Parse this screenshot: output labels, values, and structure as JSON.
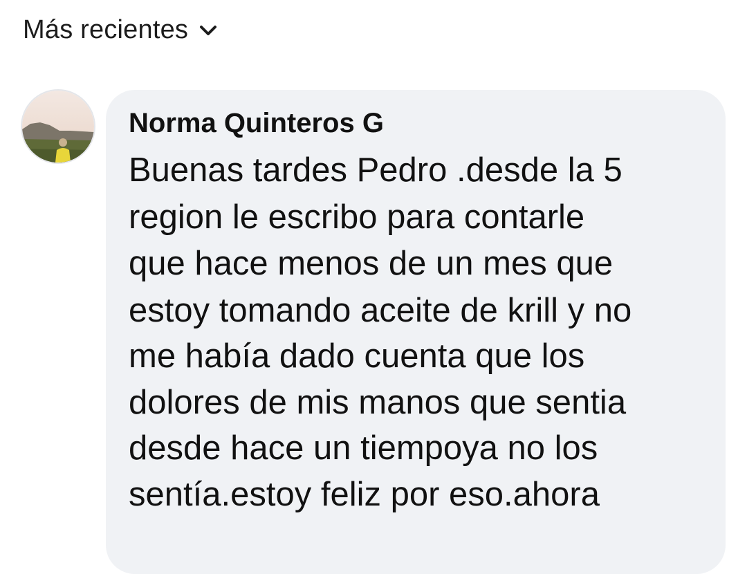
{
  "sort": {
    "label": "Más recientes",
    "icon": "chevron-down-icon"
  },
  "comment": {
    "author": "Norma Quinteros G",
    "avatar": "profile-photo",
    "bubble_color": "#f0f2f5",
    "lines": [
      "Buenas tardes Pedro .desde la 5",
      "region le escribo para contarle",
      "que hace menos de un mes que",
      "estoy tomando aceite de krill y no",
      "me había dado cuenta que los",
      "dolores de mis manos que sentia",
      "desde hace un tiempoya no los",
      "sentía.estoy feliz por eso.ahora"
    ]
  }
}
